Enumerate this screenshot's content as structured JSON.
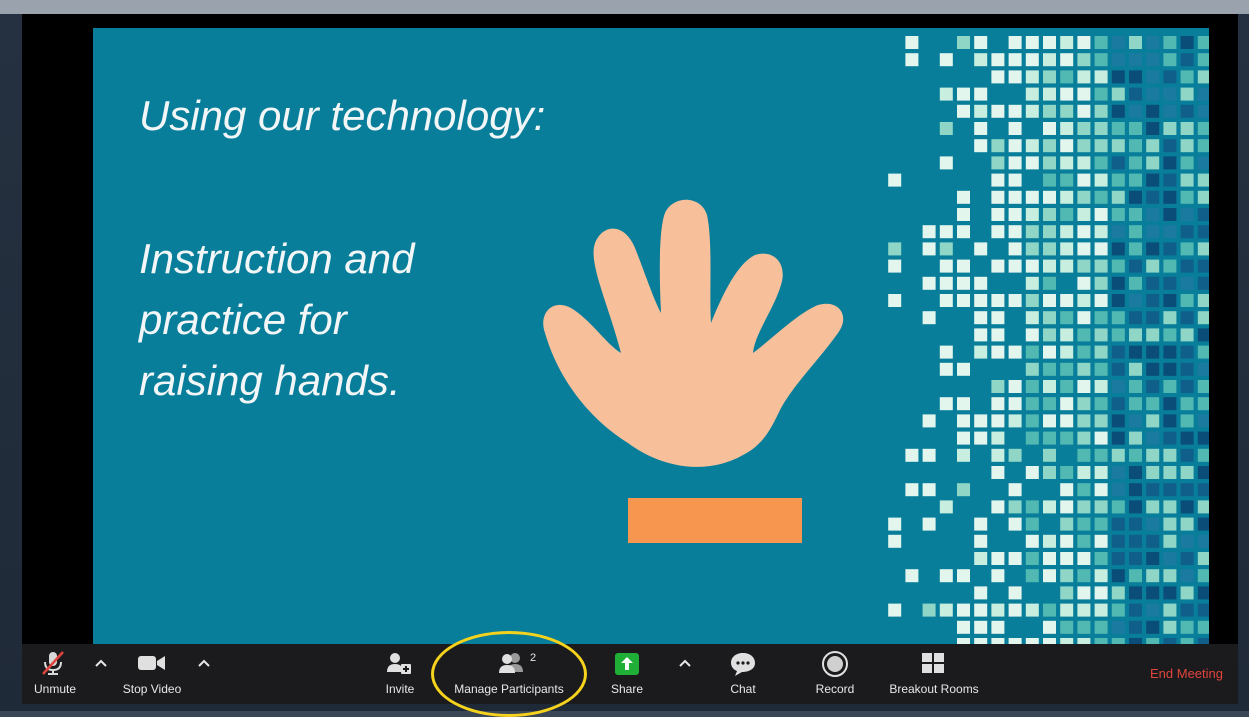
{
  "slide": {
    "title": "Using our technology:",
    "body_lines": [
      "Instruction and",
      "practice for",
      "raising hands."
    ]
  },
  "toolbar": {
    "unmute_label": "Unmute",
    "stop_video_label": "Stop Video",
    "invite_label": "Invite",
    "manage_participants_label": "Manage Participants",
    "participant_count": "2",
    "share_label": "Share",
    "chat_label": "Chat",
    "record_label": "Record",
    "breakout_rooms_label": "Breakout Rooms",
    "end_meeting_label": "End Meeting"
  },
  "icons": {
    "unmute": "muted-microphone-icon",
    "video": "video-camera-icon",
    "invite": "add-person-icon",
    "participants": "participants-icon",
    "share": "share-screen-icon",
    "chat": "chat-bubble-icon",
    "record": "record-icon",
    "breakout": "breakout-rooms-icon",
    "caret": "chevron-up-icon"
  },
  "colors": {
    "slide_background": "#087e9a",
    "hand": "#f7c09a",
    "sleeve": "#f7964e",
    "share_green": "#1fae36",
    "end_meeting_red": "#e0443c",
    "annotation_yellow": "#f4d21d"
  }
}
